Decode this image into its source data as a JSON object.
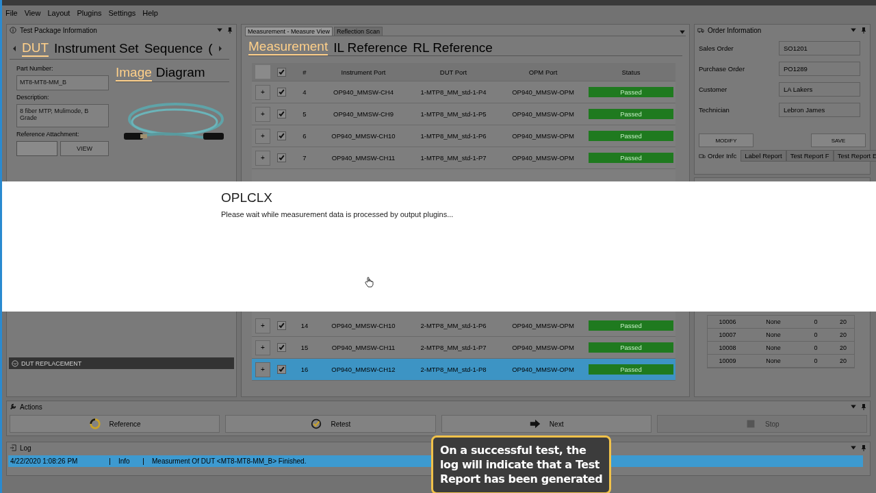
{
  "menu": [
    "File",
    "View",
    "Layout",
    "Plugins",
    "Settings",
    "Help"
  ],
  "test_package": {
    "title": "Test Package Information",
    "tabs": [
      {
        "label": "DUT",
        "selected": true
      },
      {
        "label": "Instrument Set",
        "selected": false
      },
      {
        "label": "Sequence",
        "selected": false
      },
      {
        "label": "(",
        "selected": false
      }
    ],
    "part_number_label": "Part Number:",
    "part_number": "MT8-MT8-MM_B",
    "description_label": "Description:",
    "description": "8 fiber MTP, Mulimode,  B Grade",
    "reference_label": "Reference Attachment:",
    "view_button": "VIEW",
    "image_tabs": [
      {
        "label": "Image",
        "selected": true
      },
      {
        "label": "Diagram",
        "selected": false
      }
    ],
    "dut_replacement": "DUT REPLACEMENT"
  },
  "measurement": {
    "doc_tabs": [
      {
        "label": "Measurement - Measure View",
        "selected": true
      },
      {
        "label": "Reflection Scan",
        "selected": false
      }
    ],
    "view_tabs": [
      {
        "label": "Measurement",
        "selected": true
      },
      {
        "label": "IL Reference",
        "selected": false
      },
      {
        "label": "RL Reference",
        "selected": false
      }
    ],
    "header_checked": true,
    "columns": [
      "#",
      "Instrument Port",
      "DUT Port",
      "OPM Port",
      "Status"
    ],
    "rows_top": [
      {
        "expand": "+",
        "checked": true,
        "selected": false,
        "num": "4",
        "instrument_port": "OP940_MMSW-CH4",
        "dut_port": "1-MTP8_MM_std-1-P4",
        "opm_port": "OP940_MMSW-OPM",
        "status": "Passed"
      },
      {
        "expand": "+",
        "checked": true,
        "selected": false,
        "num": "5",
        "instrument_port": "OP940_MMSW-CH9",
        "dut_port": "1-MTP8_MM_std-1-P5",
        "opm_port": "OP940_MMSW-OPM",
        "status": "Passed"
      },
      {
        "expand": "+",
        "checked": true,
        "selected": false,
        "num": "6",
        "instrument_port": "OP940_MMSW-CH10",
        "dut_port": "1-MTP8_MM_std-1-P6",
        "opm_port": "OP940_MMSW-OPM",
        "status": "Passed"
      },
      {
        "expand": "+",
        "checked": true,
        "selected": false,
        "num": "7",
        "instrument_port": "OP940_MMSW-CH11",
        "dut_port": "1-MTP8_MM_std-1-P7",
        "opm_port": "OP940_MMSW-OPM",
        "status": "Passed"
      }
    ],
    "rows_bottom": [
      {
        "expand": "+",
        "checked": true,
        "selected": false,
        "num": "14",
        "instrument_port": "OP940_MMSW-CH10",
        "dut_port": "2-MTP8_MM_std-1-P6",
        "opm_port": "OP940_MMSW-OPM",
        "status": "Passed"
      },
      {
        "expand": "+",
        "checked": true,
        "selected": false,
        "num": "15",
        "instrument_port": "OP940_MMSW-CH11",
        "dut_port": "2-MTP8_MM_std-1-P7",
        "opm_port": "OP940_MMSW-OPM",
        "status": "Passed"
      },
      {
        "expand": "+",
        "checked": true,
        "selected": true,
        "num": "16",
        "instrument_port": "OP940_MMSW-CH12",
        "dut_port": "2-MTP8_MM_std-1-P8",
        "opm_port": "OP940_MMSW-OPM",
        "status": "Passed"
      }
    ]
  },
  "order": {
    "title": "Order Information",
    "fields": [
      {
        "label": "Sales Order",
        "value": "SO1201"
      },
      {
        "label": "Purchase Order",
        "value": "PO1289"
      },
      {
        "label": "Customer",
        "value": "LA Lakers"
      },
      {
        "label": "Technician",
        "value": "Lebron James"
      }
    ],
    "buttons": [
      "MODIFY",
      "SAVE"
    ],
    "tabs": [
      {
        "label": "Order Infc",
        "selected": true
      },
      {
        "label": "Label Report",
        "selected": false
      },
      {
        "label": "Test Report F",
        "selected": false
      },
      {
        "label": "Test Report E",
        "selected": false
      }
    ]
  },
  "batch": {
    "rows": [
      [
        "10006",
        "None",
        "0",
        "20"
      ],
      [
        "10007",
        "None",
        "0",
        "20"
      ],
      [
        "10008",
        "None",
        "0",
        "20"
      ],
      [
        "10009",
        "None",
        "0",
        "20"
      ]
    ]
  },
  "actions": {
    "title": "Actions",
    "buttons": [
      {
        "kind": "reference",
        "label": "Reference",
        "disabled": false
      },
      {
        "kind": "retest",
        "label": "Retest",
        "disabled": false
      },
      {
        "kind": "next",
        "label": "Next",
        "disabled": false
      },
      {
        "kind": "stop",
        "label": "Stop",
        "disabled": true
      }
    ]
  },
  "log": {
    "title": "Log",
    "entries": [
      {
        "time": "4/22/2020 1:08:26 PM",
        "level": "Info",
        "message": "Measurment Of DUT <MT8-MT8-MM_B> Finished.",
        "selected": true
      }
    ]
  },
  "dialog": {
    "title": "OPLCLX",
    "message": "Please wait while measurement data is processed by output plugins..."
  },
  "callout": "On a successful test, the log will indicate that a Test Report has been generated"
}
